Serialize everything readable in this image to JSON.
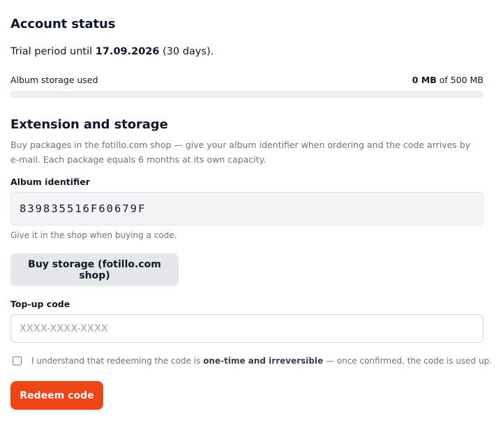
{
  "account_status": {
    "heading": "Account status",
    "trial_prefix": "Trial period until ",
    "trial_date": "17.09.2026",
    "trial_suffix": " (30 days).",
    "storage_label": "Album storage used",
    "storage_used": "0 MB",
    "storage_of": " of 500 MB",
    "storage_used_fraction": 0
  },
  "extension": {
    "heading": "Extension and storage",
    "description": "Buy packages in the fotillo.com shop — give your album identifier when ordering and the code arrives by e-mail. Each package equals 6 months at its own capacity.",
    "album_id_label": "Album identifier",
    "album_id_value": "839835516F60679F",
    "album_id_hint": "Give it in the shop when buying a code.",
    "buy_button_label": "Buy storage (fotillo.com shop)",
    "topup_label": "Top-up code",
    "topup_placeholder": "XXXX-XXXX-XXXX",
    "topup_value": "",
    "confirm_prefix": "I understand that redeeming the code is ",
    "confirm_bold": "one-time and irreversible",
    "confirm_suffix": " — once confirmed, the code is used up.",
    "confirm_checked": false,
    "redeem_button_label": "Redeem code"
  },
  "colors": {
    "accent": "#ef4416",
    "text": "#0f172a",
    "muted": "#6b7280",
    "surface": "#f3f4f6"
  },
  "icons": {
    "confirm": "checkbox-icon"
  }
}
